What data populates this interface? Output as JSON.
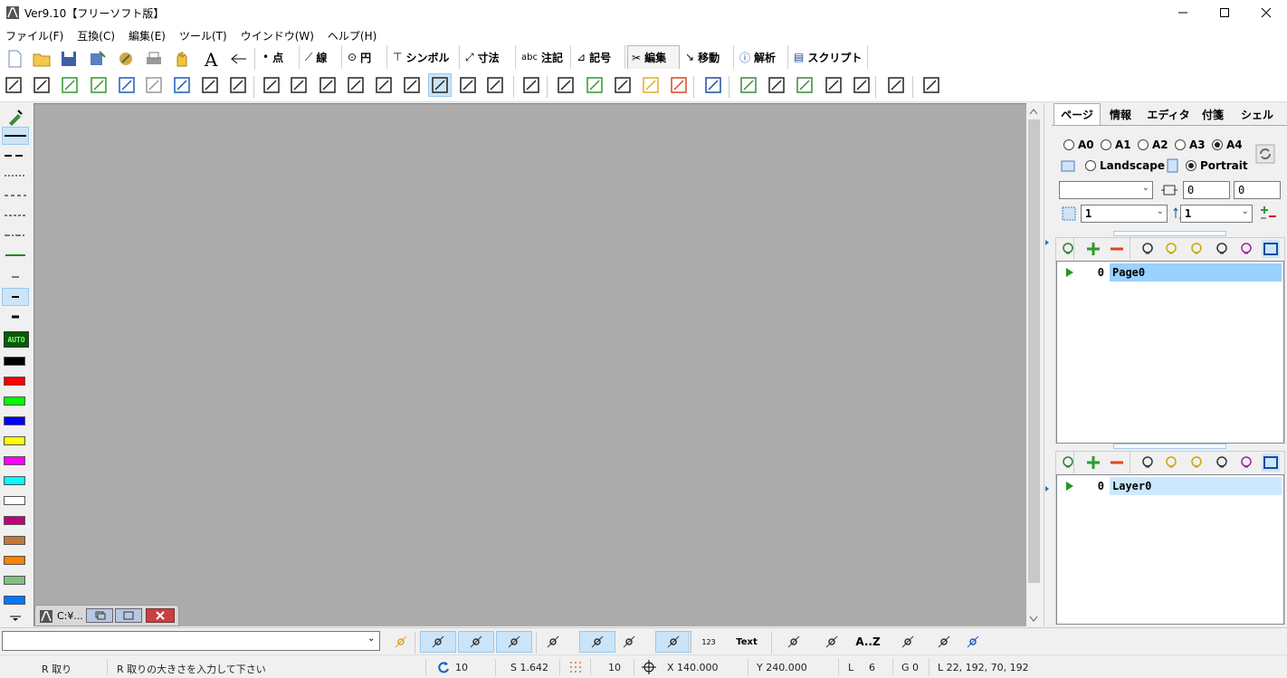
{
  "window": {
    "title": "Ver9.10【フリーソフト版】"
  },
  "menu": [
    "ファイル(F)",
    "互換(C)",
    "編集(E)",
    "ツール(T)",
    "ウインドウ(W)",
    "ヘルプ(H)"
  ],
  "mode_tabs": [
    {
      "icon": "point-icon",
      "label": "点"
    },
    {
      "icon": "line-icon",
      "label": "線"
    },
    {
      "icon": "circle-icon",
      "label": "円"
    },
    {
      "icon": "symbol-icon",
      "label": "シンボル"
    },
    {
      "icon": "dimension-icon",
      "label": "寸法"
    },
    {
      "icon": "annotation-icon",
      "label": "注記",
      "prefix": "abc"
    },
    {
      "icon": "mark-icon",
      "label": "記号"
    },
    {
      "icon": "edit-icon",
      "label": "編集",
      "active": true
    },
    {
      "icon": "move-icon",
      "label": "移動"
    },
    {
      "icon": "info-icon",
      "label": "解析"
    },
    {
      "icon": "script-icon",
      "label": "スクリプト"
    }
  ],
  "toolbar": {
    "font_glyph": "A",
    "auto_label": "AUTO"
  },
  "colors": {
    "swatches": [
      "#000000",
      "#ff0000",
      "#00ff00",
      "#0000ff",
      "#ffff00",
      "#ff00ff",
      "#00ffff",
      "#ffffff",
      "#c0007a",
      "#c07838",
      "#ff8000",
      "#80c080",
      "#0078ff"
    ],
    "canvas": "#ababab",
    "selection": "#99d1ff"
  },
  "mdi_window": {
    "title": "C:¥..."
  },
  "right_panel": {
    "tabs": [
      "ページ",
      "情報",
      "エディタ",
      "付箋",
      "シェル"
    ],
    "paper_sizes": [
      {
        "label": "A0",
        "checked": false
      },
      {
        "label": "A1",
        "checked": false
      },
      {
        "label": "A2",
        "checked": false
      },
      {
        "label": "A3",
        "checked": false
      },
      {
        "label": "A4",
        "checked": true
      }
    ],
    "orientation": {
      "landscape": "Landscape",
      "portrait": "Portrait",
      "selected": "Portrait"
    },
    "offset_x": "0",
    "offset_y": "0",
    "scale_a": "1",
    "scale_b": "1",
    "pages": [
      {
        "index": "0",
        "name": "Page0"
      }
    ],
    "layers": [
      {
        "index": "0",
        "name": "Layer0"
      }
    ]
  },
  "command_bar": {
    "input_value": "",
    "text_button": "Text",
    "az_button": "A..Z",
    "number_badge": "123"
  },
  "status": {
    "mode": "R 取り",
    "prompt": "R 取りの大きさを入力して下さい",
    "rotation": "10",
    "scale": "S 1.642",
    "grid": "10",
    "x": "X 140.000",
    "y": "Y 240.000",
    "l_label": "L",
    "l_value": "6",
    "g": "G 0",
    "layer_info": "L 22, 192, 70, 192"
  }
}
